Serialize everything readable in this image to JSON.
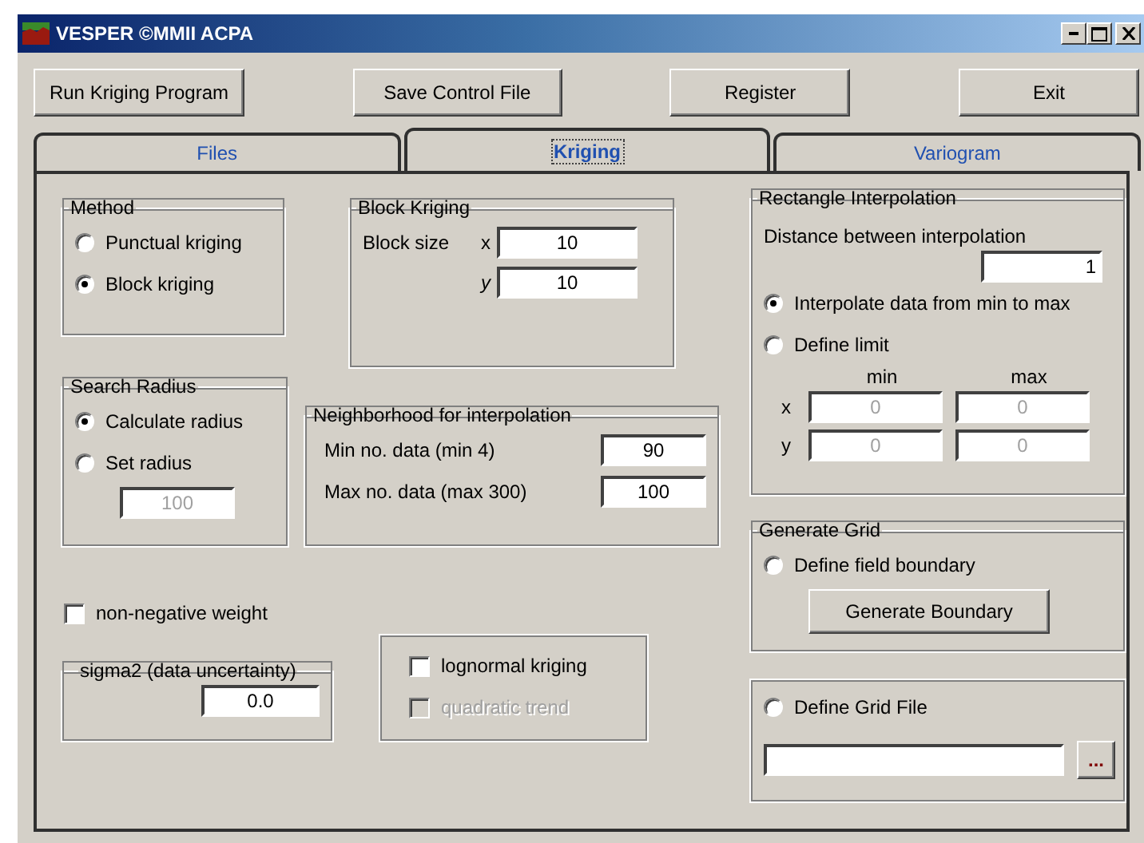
{
  "window": {
    "title": "VESPER ©MMII ACPA"
  },
  "toolbar_buttons": [
    "Run Kriging Program",
    "Save Control File",
    "Register",
    "Exit"
  ],
  "tabs": [
    {
      "label": "Files",
      "selected": false
    },
    {
      "label": "Kriging",
      "selected": true
    },
    {
      "label": "Variogram",
      "selected": false
    }
  ],
  "method": {
    "title": "Method",
    "options": [
      {
        "label": "Punctual kriging",
        "selected": false
      },
      {
        "label": "Block kriging",
        "selected": true
      }
    ]
  },
  "block_kriging": {
    "title": "Block Kriging",
    "label": "Block size",
    "x_label": "x",
    "x_value": "10",
    "y_label": "y",
    "y_value": "10"
  },
  "search_radius": {
    "title": "Search Radius",
    "options": [
      {
        "label": "Calculate radius",
        "selected": true
      },
      {
        "label": "Set radius",
        "selected": false
      }
    ],
    "radius_value": "100",
    "radius_disabled": true
  },
  "neighborhood": {
    "title": "Neighborhood for interpolation",
    "fields": [
      {
        "label": "Min no. data (min 4)",
        "value": "90"
      },
      {
        "label": "Max no. data (max 300)",
        "value": "100"
      }
    ]
  },
  "non_negative_weight": {
    "label": "non-negative weight",
    "checked": false
  },
  "sigma2": {
    "title": "sigma2 (data uncertainty)",
    "value": "0.0"
  },
  "trend_options": [
    {
      "label": "lognormal kriging",
      "checked": false,
      "disabled": false
    },
    {
      "label": "quadratic trend",
      "checked": false,
      "disabled": true
    }
  ],
  "rectangle_interpolation": {
    "title": "Rectangle Interpolation",
    "distance_label": "Distance between interpolation",
    "distance_value": "1",
    "options": [
      {
        "label": "Interpolate data from min to max",
        "selected": true
      },
      {
        "label": "Define limit",
        "selected": false
      }
    ],
    "min_label": "min",
    "max_label": "max",
    "limits_disabled": true,
    "rows": [
      {
        "label": "x",
        "min": "0",
        "max": "0"
      },
      {
        "label": "y",
        "min": "0",
        "max": "0"
      }
    ]
  },
  "generate_grid": {
    "title": "Generate Grid",
    "option": {
      "label": "Define field boundary",
      "selected": false
    },
    "button": "Generate Boundary"
  },
  "grid_file": {
    "option": {
      "label": "Define Grid File",
      "selected": false
    },
    "browse_button": "..."
  }
}
